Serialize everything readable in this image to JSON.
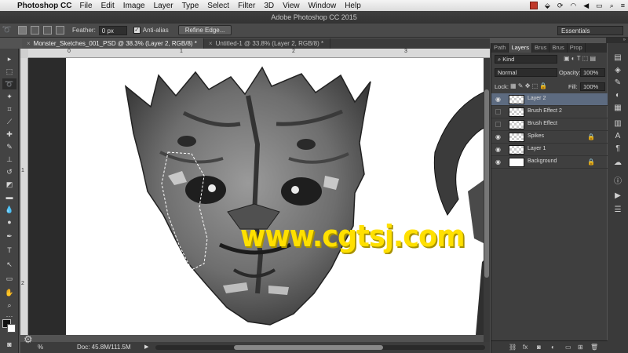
{
  "menubar": {
    "app": "Photoshop CC",
    "items": [
      "File",
      "Edit",
      "Image",
      "Layer",
      "Type",
      "Select",
      "Filter",
      "3D",
      "View",
      "Window",
      "Help"
    ]
  },
  "window": {
    "title": "Adobe Photoshop CC 2015"
  },
  "options": {
    "feather_label": "Feather:",
    "feather_value": "0 px",
    "antialias_label": "Anti-alias",
    "antialias_checked": true,
    "refine_edge_label": "Refine Edge...",
    "workspace": "Essentials"
  },
  "tabs": [
    {
      "label": "Monster_Sketches_001_PSD @ 38.3% (Layer 2, RGB/8) *",
      "active": true
    },
    {
      "label": "Untitled-1 @ 33.8% (Layer 2, RGB/8) *",
      "active": false
    }
  ],
  "rulers": {
    "top": [
      "0",
      "1",
      "2",
      "3"
    ],
    "left": [
      "1",
      "2"
    ]
  },
  "watermark": "www.cgtsj.com",
  "status": {
    "zoom": "%",
    "doc": "Doc: 45.8M/111.5M"
  },
  "panel": {
    "tabs": [
      "Path",
      "Layers",
      "Brus",
      "Brus",
      "Prop"
    ],
    "active_tab": "Layers",
    "kind_label": "Kind",
    "blend_mode": "Normal",
    "opacity_label": "Opacity:",
    "opacity_value": "100%",
    "lock_label": "Lock:",
    "fill_label": "Fill:",
    "fill_value": "100%",
    "layers": [
      {
        "name": "Layer 2",
        "visible": true,
        "selected": true,
        "locked": false
      },
      {
        "name": "Brush Effect 2",
        "visible": false,
        "selected": false,
        "locked": false
      },
      {
        "name": "Brush Effect",
        "visible": false,
        "selected": false,
        "locked": false
      },
      {
        "name": "Spikes",
        "visible": true,
        "selected": false,
        "locked": true
      },
      {
        "name": "Layer 1",
        "visible": true,
        "selected": false,
        "locked": false
      },
      {
        "name": "Background",
        "visible": true,
        "selected": false,
        "locked": true
      }
    ]
  },
  "colors": {
    "selection": "#5d6b80",
    "watermark": "#ffe000",
    "foreground": "#111111",
    "background": "#ffffff"
  }
}
